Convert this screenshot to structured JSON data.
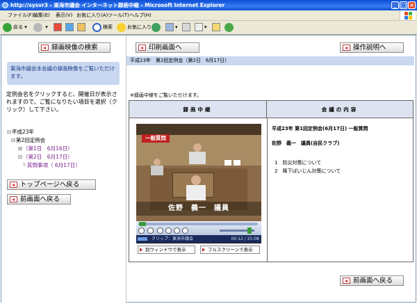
{
  "window": {
    "title": "http://sysvr3 - 東海市議会 インターネット録画中継 - Microsoft Internet Explorer",
    "controls": {
      "minimize": "_",
      "maximize": "□",
      "close": "×"
    }
  },
  "menu": [
    "ファイル(F)",
    "編集(E)",
    "表示(V)",
    "お気に入り(A)",
    "ツール(T)",
    "ヘルプ(H)"
  ],
  "toolbar": {
    "back": "戻る",
    "search": "検索",
    "favorites": "お気に入り"
  },
  "left": {
    "search_button": "録画映像の検索",
    "intro": "東海市議会本会議の録画映像をご覧いただけます。",
    "instruction": "定例会名をクリックすると、開催日が表示されますので、ご覧になりたい項目を選択（クリック）して下さい。",
    "tree": {
      "year": "平成23年",
      "session": "第2回定例会",
      "day1": "（第1日　6月16日）",
      "day2": "（第2日　6月17日）",
      "item": "質問事項（ 6月17日）"
    },
    "top_button": "トップページへ戻る",
    "back_button": "前画面へ戻る"
  },
  "right": {
    "print_button": "印刷画面へ",
    "help_button": "操作説明へ",
    "session_label": "平成23年　第2回定例会（第2日　6月17日）",
    "note": "※録画中継をご覧いただけます。",
    "table": {
      "col1": "録画中継",
      "col2": "会議の内容"
    },
    "player": {
      "caption": "一般質問",
      "nameplate": "佐野　義一　議員",
      "clip": "クリップ：東海市議会",
      "time": "00:12 / 25:08",
      "window_button": "別ウィンドウで表示",
      "fullscreen_button": "フルスクリーンで表示"
    },
    "info": {
      "title": "平成23年 第1回定例会(6月17日) 一般質問",
      "speaker": "佐野　義一　議員(自民クラブ)",
      "topics": [
        "1　防災対策について",
        "2　降下ばいじん対策について"
      ]
    },
    "back_button": "前画面へ戻る"
  },
  "colors": {
    "accent": "#c9d8f0",
    "titlebar": "#0a4fd6",
    "link": "#7a1f8f"
  }
}
